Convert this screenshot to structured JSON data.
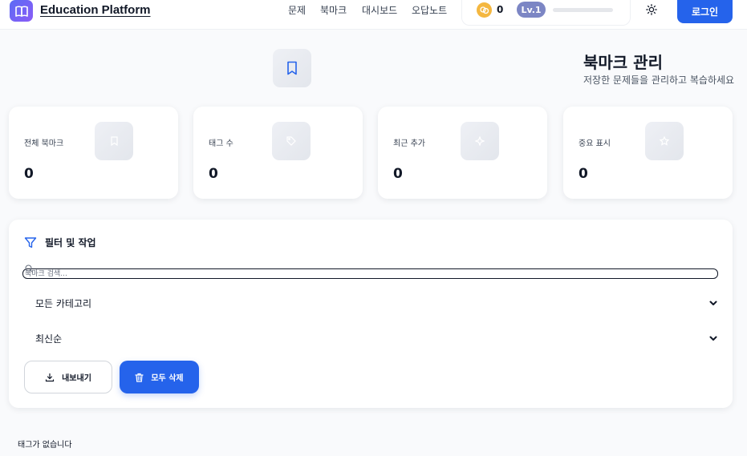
{
  "header": {
    "brand": "Education Platform",
    "nav": [
      "문제",
      "북마크",
      "대시보드",
      "오답노트"
    ],
    "coins": "0",
    "level": "Lv.1",
    "xp_progress": 0.0,
    "login_label": "로그인"
  },
  "hero": {
    "title": "북마크 관리",
    "subtitle": "저장한 문제들을 관리하고 복습하세요"
  },
  "stats": [
    {
      "label": "전체 북마크",
      "value": "0",
      "icon": "bookmark-icon"
    },
    {
      "label": "태그 수",
      "value": "0",
      "icon": "tag-icon"
    },
    {
      "label": "최근 추가",
      "value": "0",
      "icon": "sparkle-icon"
    },
    {
      "label": "중요 표시",
      "value": "0",
      "icon": "star-icon"
    }
  ],
  "filters": {
    "title": "필터 및 작업",
    "search_placeholder": "북마크 검색...",
    "category_selected": "모든 카테고리",
    "sort_selected": "최신순",
    "export_label": "내보내기",
    "delete_all_label": "모두 삭제"
  },
  "tags": {
    "empty_message": "태그가 없습니다"
  },
  "colors": {
    "primary": "#2563eb",
    "brand_gradient_start": "#5b6cf5",
    "brand_gradient_end": "#8b5cf6",
    "coin": "#f4b740",
    "level_badge": "#7c86c4"
  }
}
